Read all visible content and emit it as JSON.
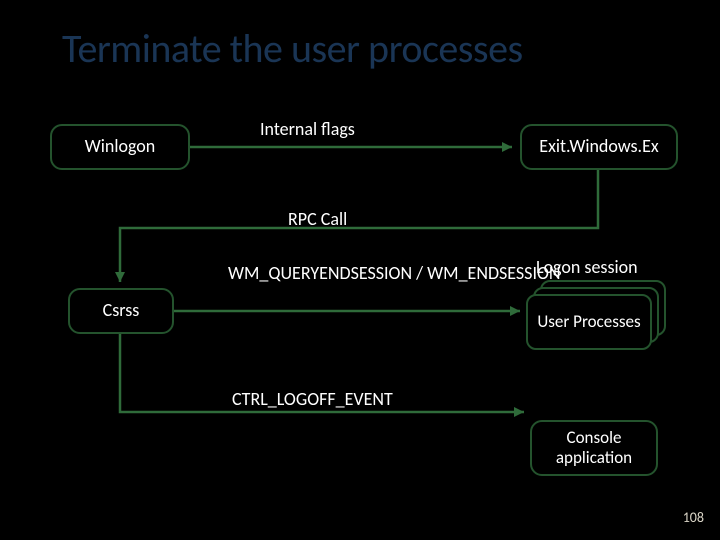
{
  "title": "Terminate the user processes",
  "nodes": {
    "winlogon": "Winlogon",
    "exitwindowsex": "Exit.Windows.Ex",
    "csrss": "Csrss",
    "user_processes": "User Processes",
    "console_app": "Console application"
  },
  "labels": {
    "internal_flags": "Internal flags",
    "rpc_call": "RPC Call",
    "wm_sessions": "WM_QUERYENDSESSION / WM_ENDSESSION",
    "ctrl_logoff": "CTRL_LOGOFF_EVENT",
    "logon_session": "Logon session"
  },
  "page_number": "108",
  "edges": [
    {
      "from": "winlogon",
      "to": "exitwindowsex",
      "label_key": "internal_flags"
    },
    {
      "from": "exitwindowsex",
      "to": "csrss",
      "label_key": "rpc_call"
    },
    {
      "from": "csrss",
      "to": "user_processes",
      "label_key": "wm_sessions"
    },
    {
      "from": "csrss",
      "to": "console_app",
      "label_key": "ctrl_logoff"
    }
  ]
}
